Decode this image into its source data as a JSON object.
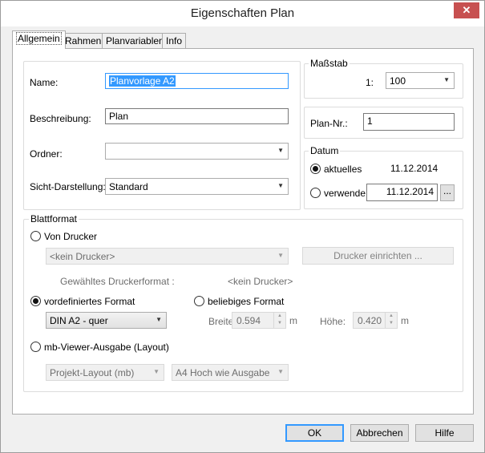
{
  "window": {
    "title": "Eigenschaften Plan",
    "close_glyph": "✕"
  },
  "tabs": [
    {
      "label": "Allgemein",
      "active": true
    },
    {
      "label": "Rahmen"
    },
    {
      "label": "Planvariablen"
    },
    {
      "label": "Info"
    }
  ],
  "general": {
    "name_label": "Name:",
    "name_value": "Planvorlage A2",
    "beschreibung_label": "Beschreibung:",
    "beschreibung_value": "Plan",
    "ordner_label": "Ordner:",
    "ordner_value": "",
    "sicht_label": "Sicht-Darstellung:",
    "sicht_value": "Standard"
  },
  "massstab": {
    "legend": "Maßstab",
    "prefix": "1:",
    "value": "100"
  },
  "plan_nr": {
    "label": "Plan-Nr.:",
    "value": "1"
  },
  "datum": {
    "legend": "Datum",
    "aktuelles_label": "aktuelles",
    "aktuelles_date": "11.12.2014",
    "verwende_label": "verwende",
    "verwende_value": "11.12.2014",
    "browse_label": "..."
  },
  "blattformat": {
    "legend": "Blattformat",
    "von_drucker_label": "Von Drucker",
    "drucker_select": "<kein Drucker>",
    "drucker_einrichten": "Drucker einrichten ...",
    "gewaehltes_label": "Gewähltes Druckerformat :",
    "gewaehltes_value": "<kein Drucker>",
    "vordefiniert_label": "vordefiniertes Format",
    "vordefiniert_value": "DIN A2 - quer",
    "beliebiges_label": "beliebiges Format",
    "breite_label": "Breite:",
    "breite_value": "0.594",
    "breite_unit": "m",
    "hoehe_label": "Höhe:",
    "hoehe_value": "0.420",
    "hoehe_unit": "m",
    "viewer_label": "mb-Viewer-Ausgabe (Layout)",
    "layout_select": "Projekt-Layout (mb)",
    "ausgabe_select": "A4 Hoch wie Ausgabe"
  },
  "buttons": {
    "ok": "OK",
    "abbrechen": "Abbrechen",
    "hilfe": "Hilfe"
  }
}
